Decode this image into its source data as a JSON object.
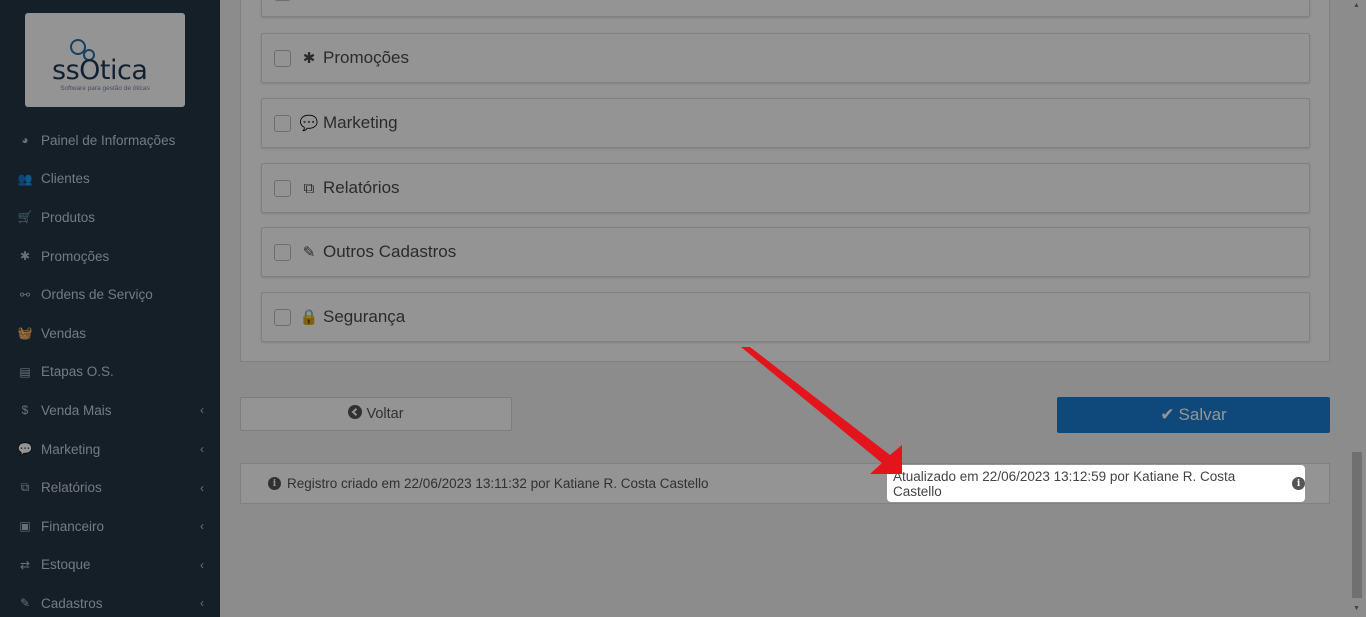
{
  "logo": {
    "text": "ssOtica",
    "subtitle": "Software para gestão de óticas"
  },
  "sidebar": {
    "items": [
      {
        "label": "Painel de Informações",
        "icon": "dashboard-icon",
        "glyph": "◕",
        "has_children": false
      },
      {
        "label": "Clientes",
        "icon": "users-icon",
        "glyph": "👥",
        "has_children": false
      },
      {
        "label": "Produtos",
        "icon": "cart-icon",
        "glyph": "🛒",
        "has_children": false
      },
      {
        "label": "Promoções",
        "icon": "asterisk-icon",
        "glyph": "✱",
        "has_children": false
      },
      {
        "label": "Ordens de Serviço",
        "icon": "glasses-icon",
        "glyph": "⚯",
        "has_children": false
      },
      {
        "label": "Vendas",
        "icon": "basket-icon",
        "glyph": "🧺",
        "has_children": false
      },
      {
        "label": "Etapas O.S.",
        "icon": "list-icon",
        "glyph": "▤",
        "has_children": false
      },
      {
        "label": "Venda Mais",
        "icon": "dollar-icon",
        "glyph": "$",
        "has_children": true
      },
      {
        "label": "Marketing",
        "icon": "comments-icon",
        "glyph": "💬",
        "has_children": true
      },
      {
        "label": "Relatórios",
        "icon": "copy-icon",
        "glyph": "⧉",
        "has_children": true
      },
      {
        "label": "Financeiro",
        "icon": "money-icon",
        "glyph": "▣",
        "has_children": true
      },
      {
        "label": "Estoque",
        "icon": "exchange-icon",
        "glyph": "⇄",
        "has_children": true
      },
      {
        "label": "Cadastros",
        "icon": "edit-icon",
        "glyph": "✎",
        "has_children": true
      }
    ],
    "chevron": "‹"
  },
  "permissions": [
    {
      "label": "Promoções",
      "icon": "asterisk-icon",
      "glyph": "✱"
    },
    {
      "label": "Marketing",
      "icon": "comments-icon",
      "glyph": "💬"
    },
    {
      "label": "Relatórios",
      "icon": "copy-icon",
      "glyph": "⧉"
    },
    {
      "label": "Outros Cadastros",
      "icon": "edit-icon",
      "glyph": "✎"
    },
    {
      "label": "Segurança",
      "icon": "lock-icon",
      "glyph": "🔒"
    }
  ],
  "buttons": {
    "back_label": "Voltar",
    "back_glyph": "➔",
    "save_label": "Salvar",
    "save_glyph": "✔"
  },
  "record_info": {
    "created": "Registro criado em 22/06/2023 13:11:32 por Katiane R. Costa Castello",
    "updated": "Atualizado em 22/06/2023 13:12:59 por Katiane R. Costa Castello",
    "info_glyph": "i"
  },
  "colors": {
    "sidebar_bg": "#253645",
    "save_button": "#1a7fd4",
    "annotation_arrow": "#e3141c"
  }
}
